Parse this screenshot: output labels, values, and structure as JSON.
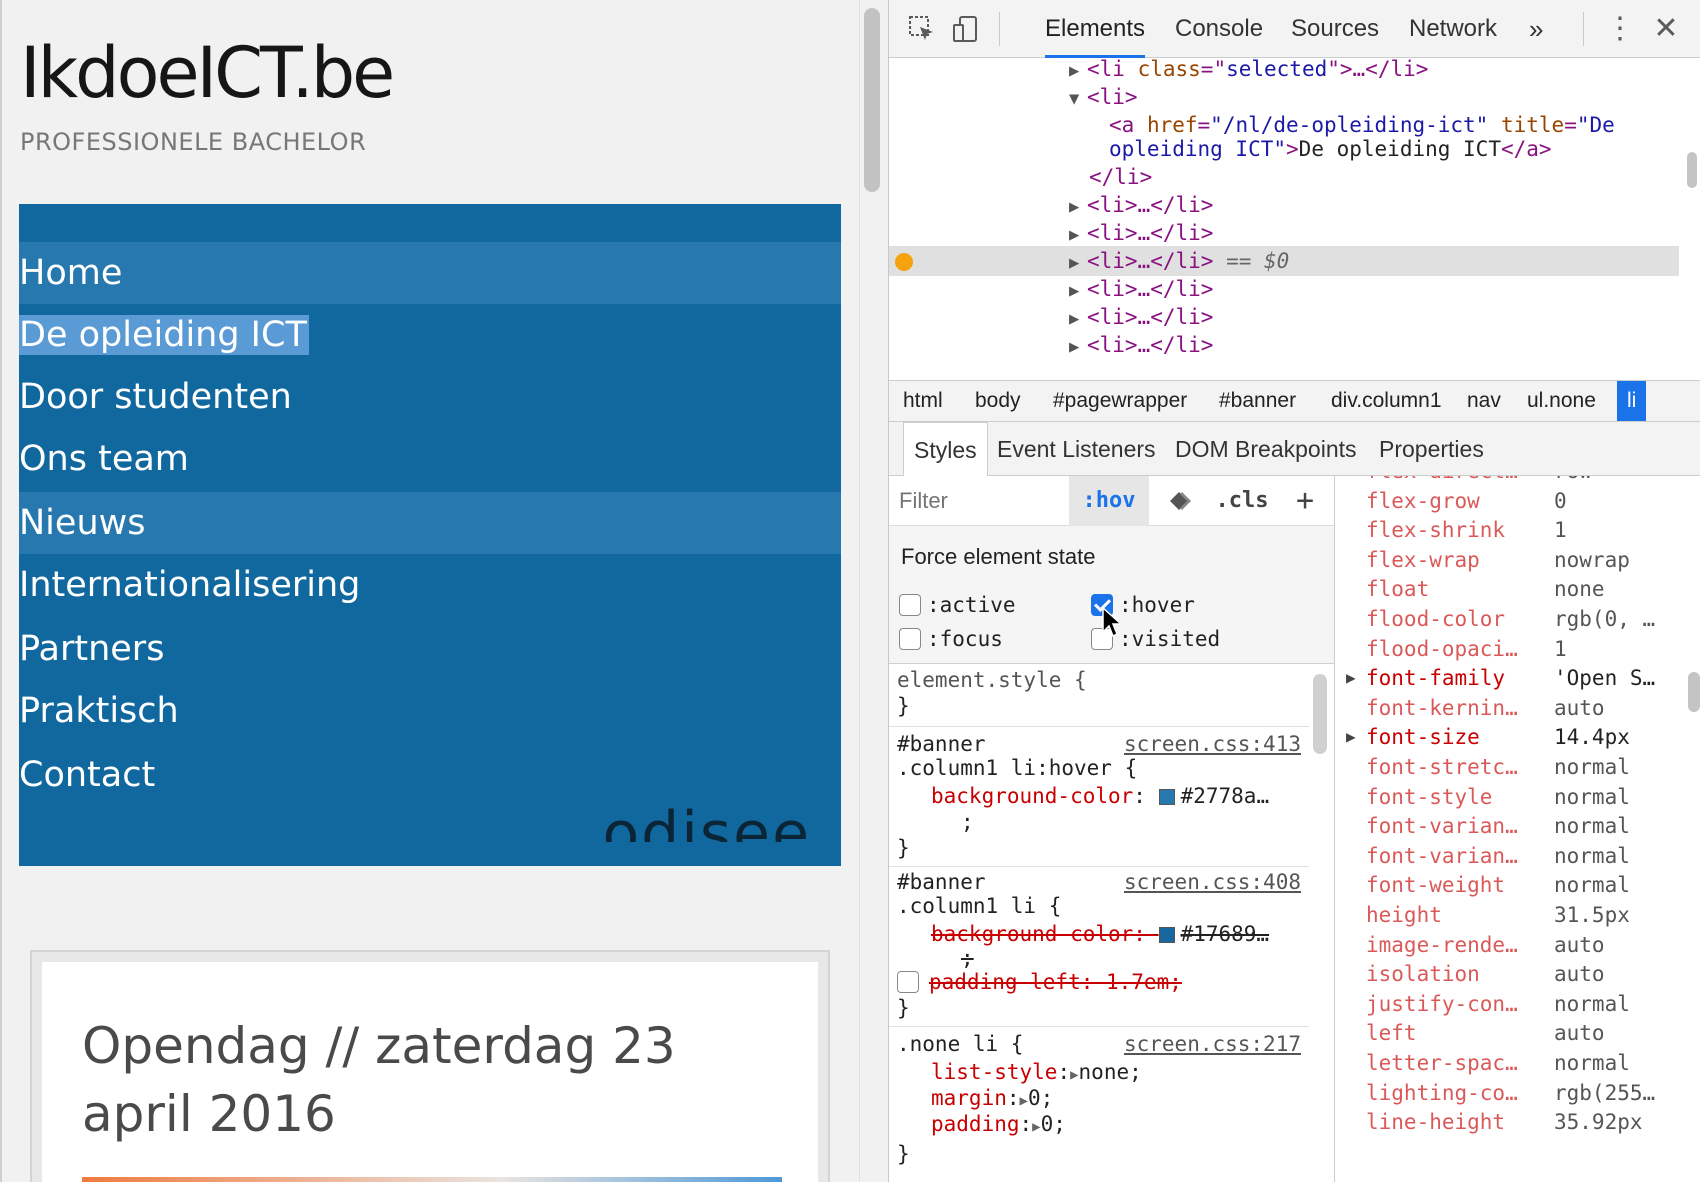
{
  "site": {
    "title": "IkdoeICT.be",
    "subtitle": "PROFESSIONELE BACHELOR",
    "nav": [
      "Home",
      "De opleiding ICT",
      "Door studenten",
      "Ons team",
      "Nieuws",
      "Internationalisering",
      "Partners",
      "Praktisch",
      "Contact"
    ],
    "logo_text": "odisee",
    "news_title": "Opendag // zaterdag 23 april 2016"
  },
  "devtools": {
    "tabs": [
      "Elements",
      "Console",
      "Sources",
      "Network"
    ],
    "more_tabs": "»",
    "dom": {
      "l1": {
        "open": "<li ",
        "attr": "class",
        "eq": "=\"",
        "val": "selected",
        "close": "\">…</li>"
      },
      "l2": "<li>",
      "l3_tag": "<a ",
      "l3_attr1": "href",
      "l3_val1": "\"/nl/de-opleiding-ict\"",
      "l3_attr2": " title",
      "l3_val2": "\"De",
      "l4_val": "opleiding ICT\"",
      "l4_tag": ">",
      "l4_text": "De opleiding ICT",
      "l4_close": "</a>",
      "l5": "</li>",
      "collapsed": "<li>…</li>",
      "selected_marker": "== $0"
    },
    "breadcrumbs": [
      "html",
      "body",
      "#pagewrapper",
      "#banner",
      "div.column1",
      "nav",
      "ul.none",
      "li"
    ],
    "subtabs": [
      "Styles",
      "Event Listeners",
      "DOM Breakpoints",
      "Properties"
    ],
    "filter_placeholder": "Filter",
    "hov_label": ":hov",
    "cls_label": ".cls",
    "plus_label": "+",
    "force_state_title": "Force element state",
    "states": {
      "active": ":active",
      "hover": ":hover",
      "focus": ":focus",
      "visited": ":visited"
    },
    "rules": {
      "element_style": "element.style {",
      "close": "}",
      "r1_sel1": "#banner",
      "r1_sel2": ".column1 li:hover {",
      "r1_src": "screen.css:413",
      "r1_prop": "background-color",
      "r1_val": "#2778a…",
      "r1_semi": ";",
      "r2_sel1": "#banner",
      "r2_sel2": ".column1 li {",
      "r2_src": "screen.css:408",
      "r2_prop": "background-color: ",
      "r2_val": "#17689…",
      "r2_semi": ";",
      "r2_prop2": "padding-left: 1.7em;",
      "r3_sel": ".none li {",
      "r3_src": "screen.css:217",
      "r3_p1": "list-style",
      "r3_v1": "none;",
      "r3_p2": "margin",
      "r3_v2": "0;",
      "r3_p3": "padding",
      "r3_v3": "0;"
    },
    "computed": [
      {
        "name": "flex-direct…",
        "value": "row"
      },
      {
        "name": "flex-grow",
        "value": "0"
      },
      {
        "name": "flex-shrink",
        "value": "1"
      },
      {
        "name": "flex-wrap",
        "value": "nowrap"
      },
      {
        "name": "float",
        "value": "none"
      },
      {
        "name": "flood-color",
        "value": "rgb(0, …"
      },
      {
        "name": "flood-opaci…",
        "value": "1"
      },
      {
        "name": "font-family",
        "value": "'Open S…"
      },
      {
        "name": "font-kernin…",
        "value": "auto"
      },
      {
        "name": "font-size",
        "value": "14.4px"
      },
      {
        "name": "font-stretc…",
        "value": "normal"
      },
      {
        "name": "font-style",
        "value": "normal"
      },
      {
        "name": "font-varian…",
        "value": "normal"
      },
      {
        "name": "font-varian…",
        "value": "normal"
      },
      {
        "name": "font-weight",
        "value": "normal"
      },
      {
        "name": "height",
        "value": "31.5px"
      },
      {
        "name": "image-rende…",
        "value": "auto"
      },
      {
        "name": "isolation",
        "value": "auto"
      },
      {
        "name": "justify-con…",
        "value": "normal"
      },
      {
        "name": "left",
        "value": "auto"
      },
      {
        "name": "letter-spac…",
        "value": "normal"
      },
      {
        "name": "lighting-co…",
        "value": "rgb(255…"
      },
      {
        "name": "line-height",
        "value": "35.92px"
      }
    ],
    "colors": {
      "hover_bg": "#2778ae",
      "banner_bg": "#17689f",
      "accent": "#1a73e8"
    }
  }
}
